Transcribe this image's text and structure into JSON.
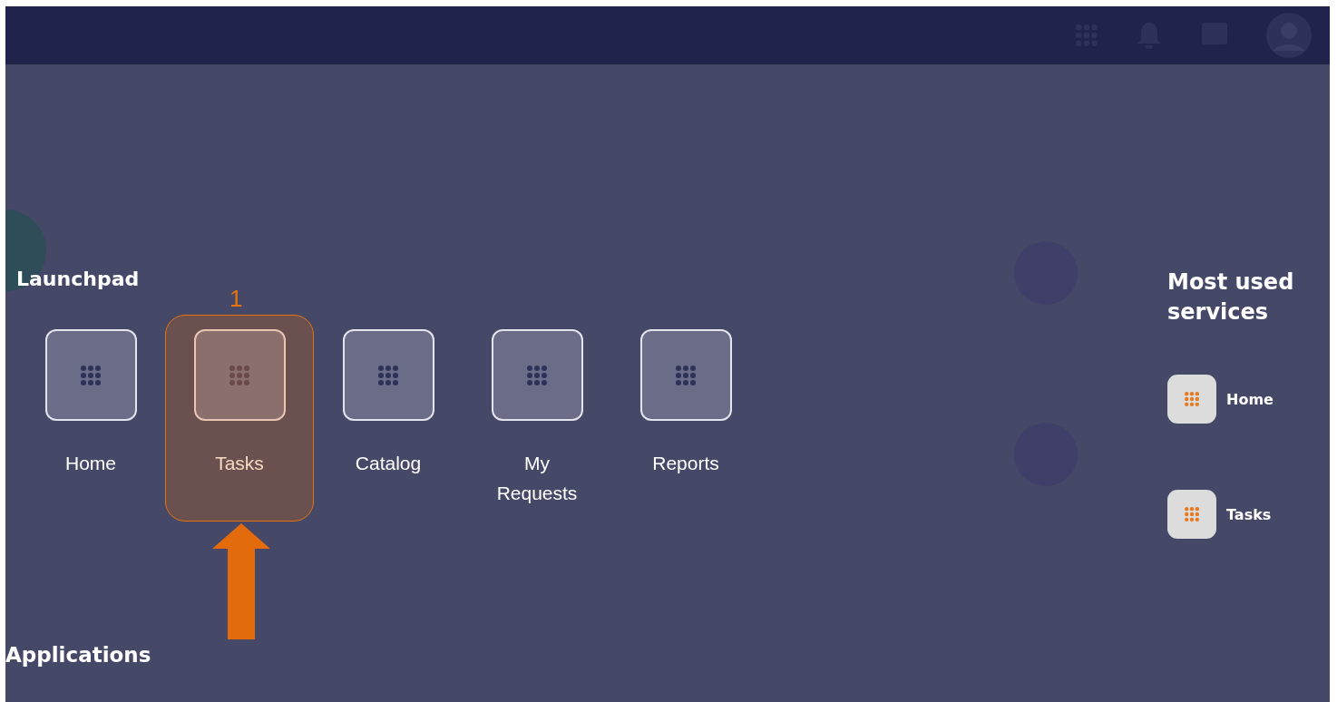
{
  "launchpad": {
    "title": "Launchpad",
    "step_number": "1",
    "tiles": [
      {
        "label": "Home",
        "selected": false
      },
      {
        "label": "Tasks",
        "selected": true
      },
      {
        "label": "Catalog",
        "selected": false
      },
      {
        "label": "My Requests",
        "selected": false
      },
      {
        "label": "Reports",
        "selected": false
      }
    ]
  },
  "most_used": {
    "title": "Most used services",
    "items": [
      {
        "label": "Home"
      },
      {
        "label": "Tasks"
      }
    ]
  },
  "applications_title": "Applications"
}
